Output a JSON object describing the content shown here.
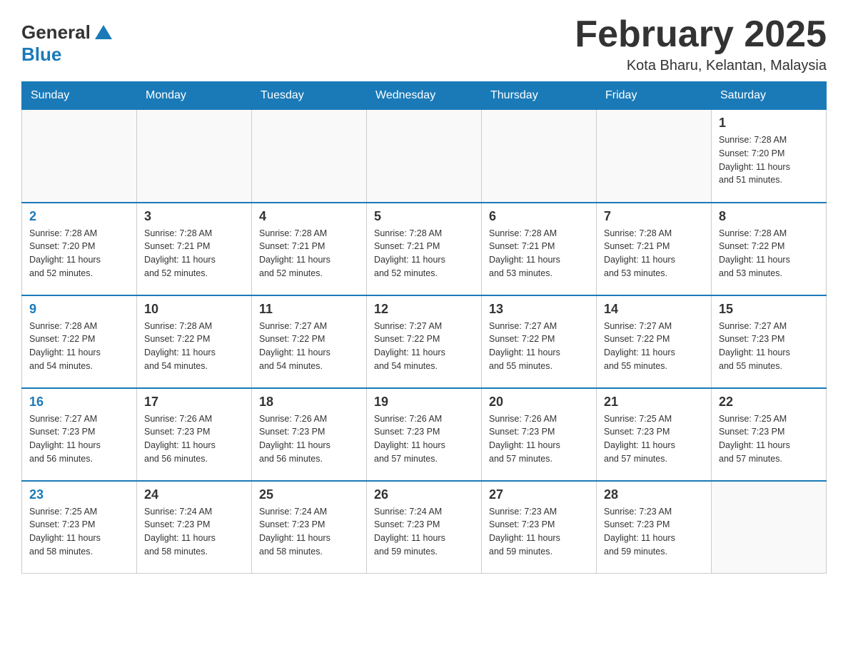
{
  "header": {
    "logo_general": "General",
    "logo_blue": "Blue",
    "title": "February 2025",
    "location": "Kota Bharu, Kelantan, Malaysia"
  },
  "days_of_week": [
    "Sunday",
    "Monday",
    "Tuesday",
    "Wednesday",
    "Thursday",
    "Friday",
    "Saturday"
  ],
  "weeks": [
    [
      {
        "day": "",
        "info": ""
      },
      {
        "day": "",
        "info": ""
      },
      {
        "day": "",
        "info": ""
      },
      {
        "day": "",
        "info": ""
      },
      {
        "day": "",
        "info": ""
      },
      {
        "day": "",
        "info": ""
      },
      {
        "day": "1",
        "info": "Sunrise: 7:28 AM\nSunset: 7:20 PM\nDaylight: 11 hours\nand 51 minutes."
      }
    ],
    [
      {
        "day": "2",
        "info": "Sunrise: 7:28 AM\nSunset: 7:20 PM\nDaylight: 11 hours\nand 52 minutes."
      },
      {
        "day": "3",
        "info": "Sunrise: 7:28 AM\nSunset: 7:21 PM\nDaylight: 11 hours\nand 52 minutes."
      },
      {
        "day": "4",
        "info": "Sunrise: 7:28 AM\nSunset: 7:21 PM\nDaylight: 11 hours\nand 52 minutes."
      },
      {
        "day": "5",
        "info": "Sunrise: 7:28 AM\nSunset: 7:21 PM\nDaylight: 11 hours\nand 52 minutes."
      },
      {
        "day": "6",
        "info": "Sunrise: 7:28 AM\nSunset: 7:21 PM\nDaylight: 11 hours\nand 53 minutes."
      },
      {
        "day": "7",
        "info": "Sunrise: 7:28 AM\nSunset: 7:21 PM\nDaylight: 11 hours\nand 53 minutes."
      },
      {
        "day": "8",
        "info": "Sunrise: 7:28 AM\nSunset: 7:22 PM\nDaylight: 11 hours\nand 53 minutes."
      }
    ],
    [
      {
        "day": "9",
        "info": "Sunrise: 7:28 AM\nSunset: 7:22 PM\nDaylight: 11 hours\nand 54 minutes."
      },
      {
        "day": "10",
        "info": "Sunrise: 7:28 AM\nSunset: 7:22 PM\nDaylight: 11 hours\nand 54 minutes."
      },
      {
        "day": "11",
        "info": "Sunrise: 7:27 AM\nSunset: 7:22 PM\nDaylight: 11 hours\nand 54 minutes."
      },
      {
        "day": "12",
        "info": "Sunrise: 7:27 AM\nSunset: 7:22 PM\nDaylight: 11 hours\nand 54 minutes."
      },
      {
        "day": "13",
        "info": "Sunrise: 7:27 AM\nSunset: 7:22 PM\nDaylight: 11 hours\nand 55 minutes."
      },
      {
        "day": "14",
        "info": "Sunrise: 7:27 AM\nSunset: 7:22 PM\nDaylight: 11 hours\nand 55 minutes."
      },
      {
        "day": "15",
        "info": "Sunrise: 7:27 AM\nSunset: 7:23 PM\nDaylight: 11 hours\nand 55 minutes."
      }
    ],
    [
      {
        "day": "16",
        "info": "Sunrise: 7:27 AM\nSunset: 7:23 PM\nDaylight: 11 hours\nand 56 minutes."
      },
      {
        "day": "17",
        "info": "Sunrise: 7:26 AM\nSunset: 7:23 PM\nDaylight: 11 hours\nand 56 minutes."
      },
      {
        "day": "18",
        "info": "Sunrise: 7:26 AM\nSunset: 7:23 PM\nDaylight: 11 hours\nand 56 minutes."
      },
      {
        "day": "19",
        "info": "Sunrise: 7:26 AM\nSunset: 7:23 PM\nDaylight: 11 hours\nand 57 minutes."
      },
      {
        "day": "20",
        "info": "Sunrise: 7:26 AM\nSunset: 7:23 PM\nDaylight: 11 hours\nand 57 minutes."
      },
      {
        "day": "21",
        "info": "Sunrise: 7:25 AM\nSunset: 7:23 PM\nDaylight: 11 hours\nand 57 minutes."
      },
      {
        "day": "22",
        "info": "Sunrise: 7:25 AM\nSunset: 7:23 PM\nDaylight: 11 hours\nand 57 minutes."
      }
    ],
    [
      {
        "day": "23",
        "info": "Sunrise: 7:25 AM\nSunset: 7:23 PM\nDaylight: 11 hours\nand 58 minutes."
      },
      {
        "day": "24",
        "info": "Sunrise: 7:24 AM\nSunset: 7:23 PM\nDaylight: 11 hours\nand 58 minutes."
      },
      {
        "day": "25",
        "info": "Sunrise: 7:24 AM\nSunset: 7:23 PM\nDaylight: 11 hours\nand 58 minutes."
      },
      {
        "day": "26",
        "info": "Sunrise: 7:24 AM\nSunset: 7:23 PM\nDaylight: 11 hours\nand 59 minutes."
      },
      {
        "day": "27",
        "info": "Sunrise: 7:23 AM\nSunset: 7:23 PM\nDaylight: 11 hours\nand 59 minutes."
      },
      {
        "day": "28",
        "info": "Sunrise: 7:23 AM\nSunset: 7:23 PM\nDaylight: 11 hours\nand 59 minutes."
      },
      {
        "day": "",
        "info": ""
      }
    ]
  ]
}
